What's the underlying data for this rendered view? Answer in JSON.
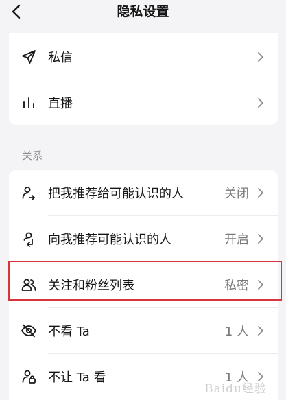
{
  "header": {
    "title": "隐私设置"
  },
  "group1": {
    "items": [
      {
        "label": "私信",
        "icon": "paper-plane-icon"
      },
      {
        "label": "直播",
        "icon": "bars-icon"
      }
    ]
  },
  "group2": {
    "section_label": "关系",
    "items": [
      {
        "label": "把我推荐给可能认识的人",
        "value": "关闭",
        "icon": "user-share-out-icon"
      },
      {
        "label": "向我推荐可能认识的人",
        "value": "开启",
        "icon": "user-share-in-icon"
      },
      {
        "label": "关注和粉丝列表",
        "value": "私密",
        "icon": "users-icon"
      },
      {
        "label": "不看 Ta",
        "value": "1 人",
        "icon": "eye-slash-icon"
      },
      {
        "label": "不让 Ta 看",
        "value": "1 人",
        "icon": "user-lock-icon"
      }
    ]
  },
  "watermark": {
    "text": "Baidu经验"
  },
  "colors": {
    "highlight": "#d7353b",
    "background": "#f4f4f6"
  }
}
